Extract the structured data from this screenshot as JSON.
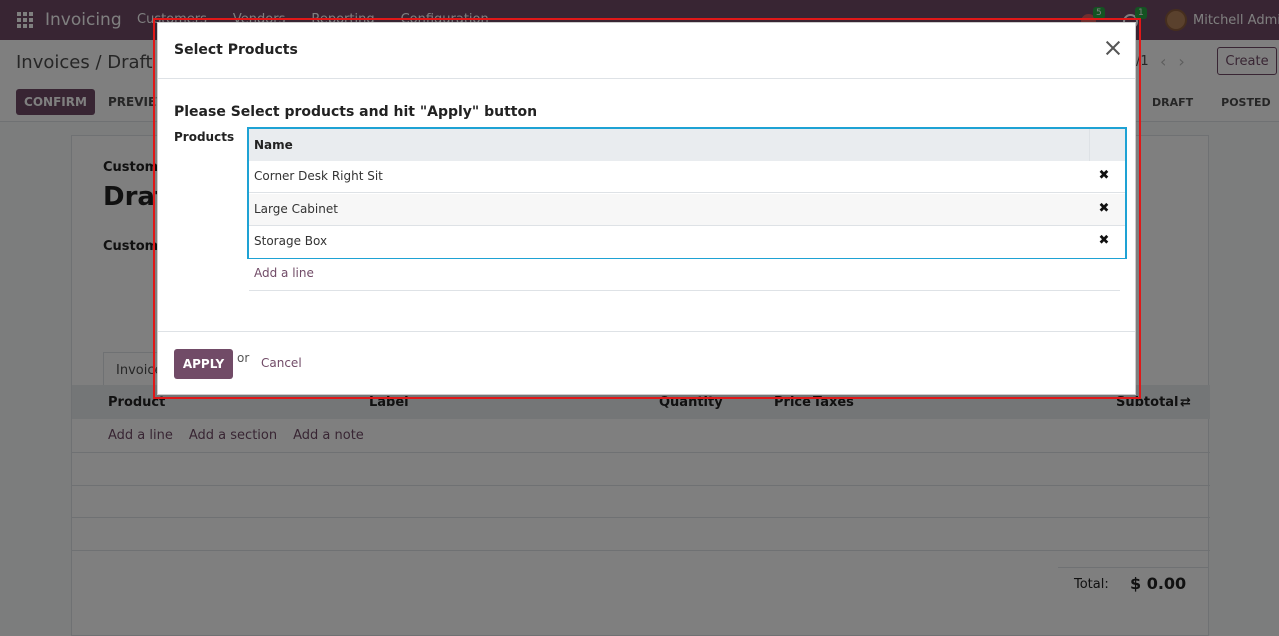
{
  "navbar": {
    "app_name": "Invoicing",
    "menu": [
      "Customers",
      "Vendors",
      "Reporting",
      "Configuration"
    ],
    "activity_badge": "5",
    "clock_badge": "1",
    "user_name": "Mitchell Admin"
  },
  "control": {
    "breadcrumb": "Invoices / Draft In",
    "pager": "/1",
    "create_label": "Create",
    "confirm_label": "CONFIRM",
    "preview_label": "PREVIEW",
    "statuses": [
      "DRAFT",
      "POSTED"
    ]
  },
  "form": {
    "customer_label": "Customer",
    "title": "Draft",
    "customer_label2": "Customer",
    "tab_invoice": "Invoice",
    "columns": [
      "Product",
      "Label",
      "Quantity",
      "Price",
      "Taxes",
      "Subtotal"
    ],
    "add_links": [
      "Add a line",
      "Add a section",
      "Add a note"
    ],
    "total_label": "Total:",
    "total_value": "$ 0.00"
  },
  "modal": {
    "title": "Select Products",
    "subtitle": "Please Select products and hit \"Apply\" button",
    "field_label": "Products",
    "table_header": "Name",
    "products": [
      "Corner Desk Right Sit",
      "Large Cabinet",
      "Storage Box"
    ],
    "add_line": "Add a line",
    "apply_label": "APPLY",
    "or_text": "or",
    "cancel_label": "Cancel"
  },
  "colors": {
    "brand": "#714b67",
    "highlight": "#e01818",
    "focus": "#1ea2d4"
  }
}
